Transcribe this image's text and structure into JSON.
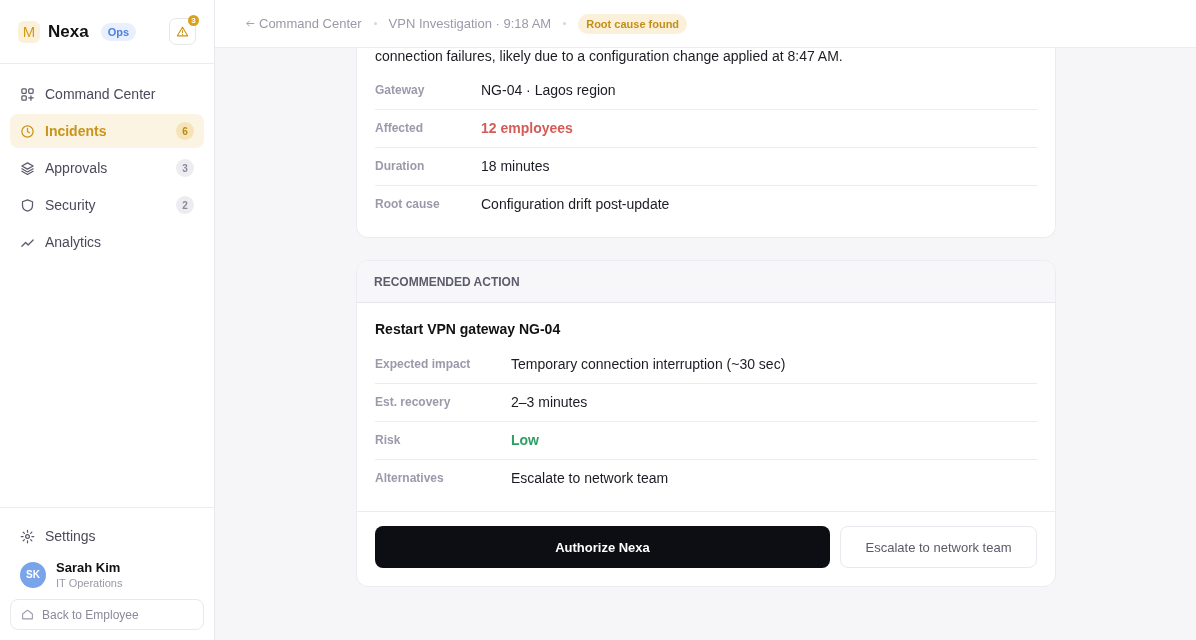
{
  "brand": {
    "logo": "M",
    "name": "Nexa",
    "tag": "Ops",
    "alert_count": "3"
  },
  "nav": [
    {
      "label": "Command Center",
      "selected": false
    },
    {
      "label": "Incidents",
      "selected": true,
      "count": "6"
    },
    {
      "label": "Approvals",
      "selected": false,
      "count": "3"
    },
    {
      "label": "Security",
      "selected": false,
      "count": "2"
    },
    {
      "label": "Analytics",
      "selected": false
    }
  ],
  "settings": {
    "label": "Settings"
  },
  "user": {
    "initials": "SK",
    "name": "Sarah Kim",
    "role": "IT Operations"
  },
  "back_button": "Back to Employee",
  "header": {
    "back": "Command Center",
    "title": "VPN Investigation · 9:18 AM",
    "status": "Root cause found"
  },
  "summary": {
    "text": "connection failures, likely due to a configuration change applied at 8:47 AM.",
    "rows": [
      {
        "label": "Gateway",
        "value": "NG-04 · Lagos region",
        "kind": "plain"
      },
      {
        "label": "Affected",
        "value": "12 employees",
        "kind": "danger"
      },
      {
        "label": "Duration",
        "value": "18 minutes",
        "kind": "plain"
      },
      {
        "label": "Root cause",
        "value": "Configuration drift post-update",
        "kind": "plain"
      }
    ]
  },
  "action": {
    "heading": "RECOMMENDED ACTION",
    "title": "Restart VPN gateway NG-04",
    "rows": [
      {
        "label": "Expected impact",
        "value": "Temporary connection interruption (~30 sec)",
        "kind": "plain"
      },
      {
        "label": "Est. recovery",
        "value": "2–3 minutes",
        "kind": "plain"
      },
      {
        "label": "Risk",
        "value": "Low",
        "kind": "success"
      },
      {
        "label": "Alternatives",
        "value": "Escalate to network team",
        "kind": "plain"
      }
    ],
    "primary_button": "Authorize Nexa",
    "secondary_button": "Escalate to network team"
  }
}
